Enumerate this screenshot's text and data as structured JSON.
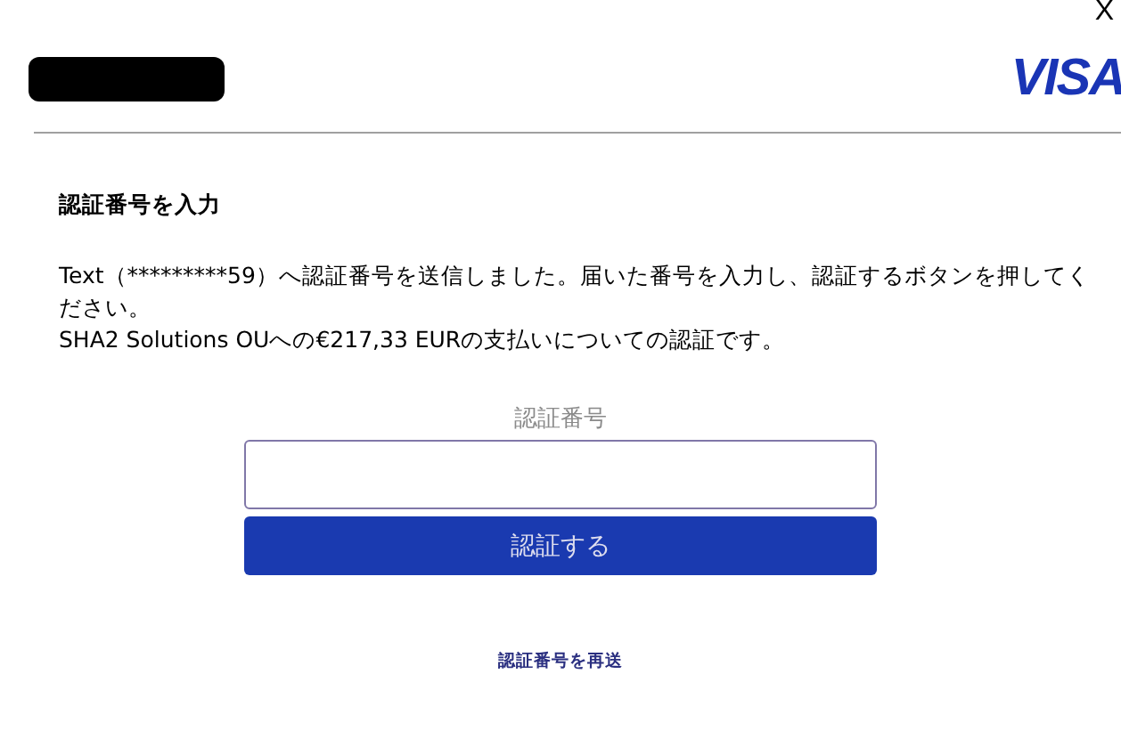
{
  "close_button": {
    "label": "X"
  },
  "header": {
    "logo": "VISA"
  },
  "title": "認証番号を入力",
  "message": [
    "Text（*********59）へ認証番号を送信しました。届いた番号を入力し、認証するボタンを押してください。",
    "SHA2 Solutions OUへの€217,33 EURの支払いについての認証です。"
  ],
  "code_field": {
    "label": "認証番号"
  },
  "submit_button": {
    "label": "認証する"
  },
  "resend_link": {
    "label": "認証番号を再送"
  }
}
